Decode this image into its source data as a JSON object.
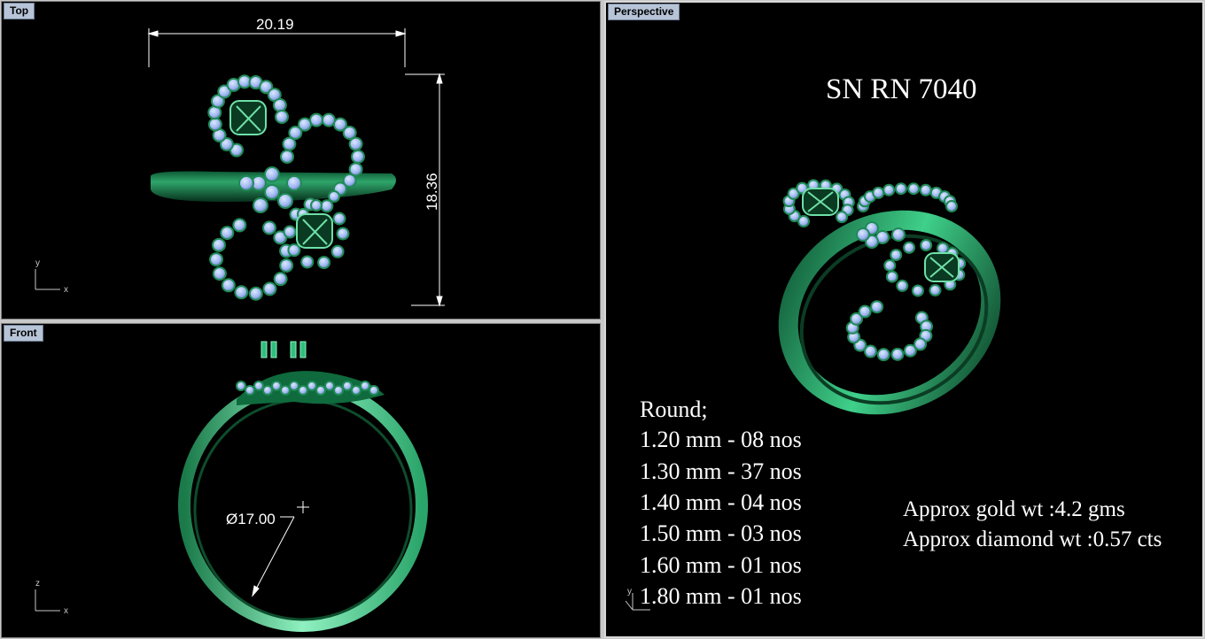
{
  "viewports": {
    "top": {
      "label": "Top",
      "dim_width": "20.19",
      "dim_height": "18.36",
      "axis_y": "y",
      "axis_x": "x"
    },
    "front": {
      "label": "Front",
      "dim_diameter": "Ø17.00",
      "axis_z": "z",
      "axis_x": "x"
    },
    "perspective": {
      "label": "Perspective",
      "title": "SN RN 7040",
      "stone_heading": "Round;",
      "stones": [
        "1.20 mm - 08 nos",
        "1.30 mm - 37 nos",
        "1.40 mm - 04 nos",
        "1.50 mm - 03 nos",
        "1.60 mm - 01 nos",
        "1.80 mm - 01 nos"
      ],
      "gold_wt": "Approx gold wt :4.2 gms",
      "diamond_wt": "Approx diamond wt :0.57 cts",
      "axis_y": "y"
    }
  },
  "colors": {
    "metal": "#1f8a55",
    "metal_light": "#6fe0a8",
    "stone": "#9fb8f0",
    "background": "#000000",
    "label_bg": "#b7c4d8"
  }
}
